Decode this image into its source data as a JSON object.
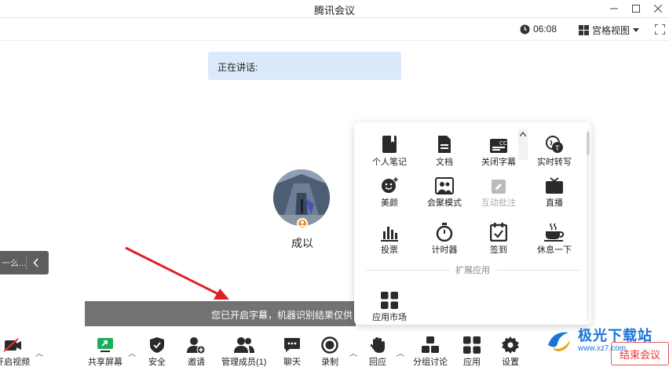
{
  "window": {
    "title": "腾讯会议",
    "min_icon": "minimize-icon",
    "max_icon": "maximize-icon",
    "close_icon": "close-icon"
  },
  "header": {
    "timer": "06:08",
    "view_mode": "宫格视图"
  },
  "speaking": {
    "label": "正在讲话:"
  },
  "participant": {
    "name": "成以"
  },
  "chat": {
    "preview": "一么..."
  },
  "subtitle": {
    "text": "您已开启字幕，机器识别结果仅供"
  },
  "panel": {
    "items": [
      {
        "label": "个人笔记",
        "icon": "notebook-icon"
      },
      {
        "label": "文档",
        "icon": "document-icon"
      },
      {
        "label": "关闭字幕",
        "icon": "captions-icon"
      },
      {
        "label": "实时转写",
        "icon": "transcribe-icon"
      },
      {
        "label": "美颜",
        "icon": "beauty-icon"
      },
      {
        "label": "会聚模式",
        "icon": "gathering-mode-icon"
      },
      {
        "label": "互动批注",
        "icon": "annotate-icon",
        "disabled": true
      },
      {
        "label": "直播",
        "icon": "live-icon"
      },
      {
        "label": "投票",
        "icon": "vote-icon"
      },
      {
        "label": "计时器",
        "icon": "timer-icon"
      },
      {
        "label": "签到",
        "icon": "checkin-icon"
      },
      {
        "label": "休息一下",
        "icon": "coffee-icon"
      }
    ],
    "ext_section": "扩展应用",
    "ext_items": [
      {
        "label": "应用市场",
        "icon": "app-market-icon"
      }
    ]
  },
  "toolbar": {
    "items": [
      {
        "label": "开启视频",
        "icon": "camera-off-icon"
      },
      {
        "label": "共享屏幕",
        "icon": "share-screen-icon"
      },
      {
        "label": "安全",
        "icon": "shield-icon"
      },
      {
        "label": "邀请",
        "icon": "invite-icon"
      },
      {
        "label": "管理成员(1)",
        "icon": "members-icon"
      },
      {
        "label": "聊天",
        "icon": "chat-icon"
      },
      {
        "label": "录制",
        "icon": "record-icon"
      },
      {
        "label": "回应",
        "icon": "reaction-icon"
      },
      {
        "label": "分组讨论",
        "icon": "breakout-icon"
      },
      {
        "label": "应用",
        "icon": "apps-icon"
      },
      {
        "label": "设置",
        "icon": "settings-icon"
      }
    ],
    "end_label": "结束会议"
  },
  "watermark": {
    "name": "极光下载站",
    "url": "www.xz7.com"
  },
  "colors": {
    "accent": "#1a73d9",
    "speaking_bg": "#dbe9fb",
    "host_badge": "#f08a1d",
    "end_red": "#e33333",
    "share_green": "#1aad5b"
  }
}
